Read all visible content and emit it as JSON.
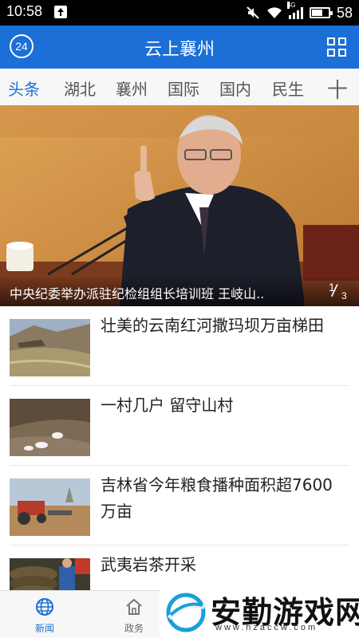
{
  "status_bar": {
    "time": "10:58",
    "network_type": "4G",
    "battery_level": "58"
  },
  "header": {
    "badge": "24",
    "title": "云上襄州"
  },
  "tabs": [
    {
      "label": "头条",
      "active": true
    },
    {
      "label": "湖北",
      "active": false
    },
    {
      "label": "襄州",
      "active": false
    },
    {
      "label": "国际",
      "active": false
    },
    {
      "label": "国内",
      "active": false
    },
    {
      "label": "民生",
      "active": false
    }
  ],
  "tab_add_symbol": "十",
  "hero": {
    "caption": "中央纪委举办派驻纪检组组长培训班 王岐山..",
    "page_current": "1",
    "page_total": "3"
  },
  "news": [
    {
      "title": "壮美的云南红河撒玛坝万亩梯田"
    },
    {
      "title": "一村几户 留守山村"
    },
    {
      "title": "吉林省今年粮食播种面积超7600万亩"
    },
    {
      "title": "武夷岩茶开采"
    }
  ],
  "bottom_nav": [
    {
      "label": "新闻",
      "active": true
    },
    {
      "label": "政务",
      "active": false
    }
  ],
  "watermark": {
    "text": "安勤游戏网",
    "url": "www.hzaccw.com"
  },
  "colors": {
    "brand": "#1b6fd6",
    "status_bar": "#000000"
  }
}
